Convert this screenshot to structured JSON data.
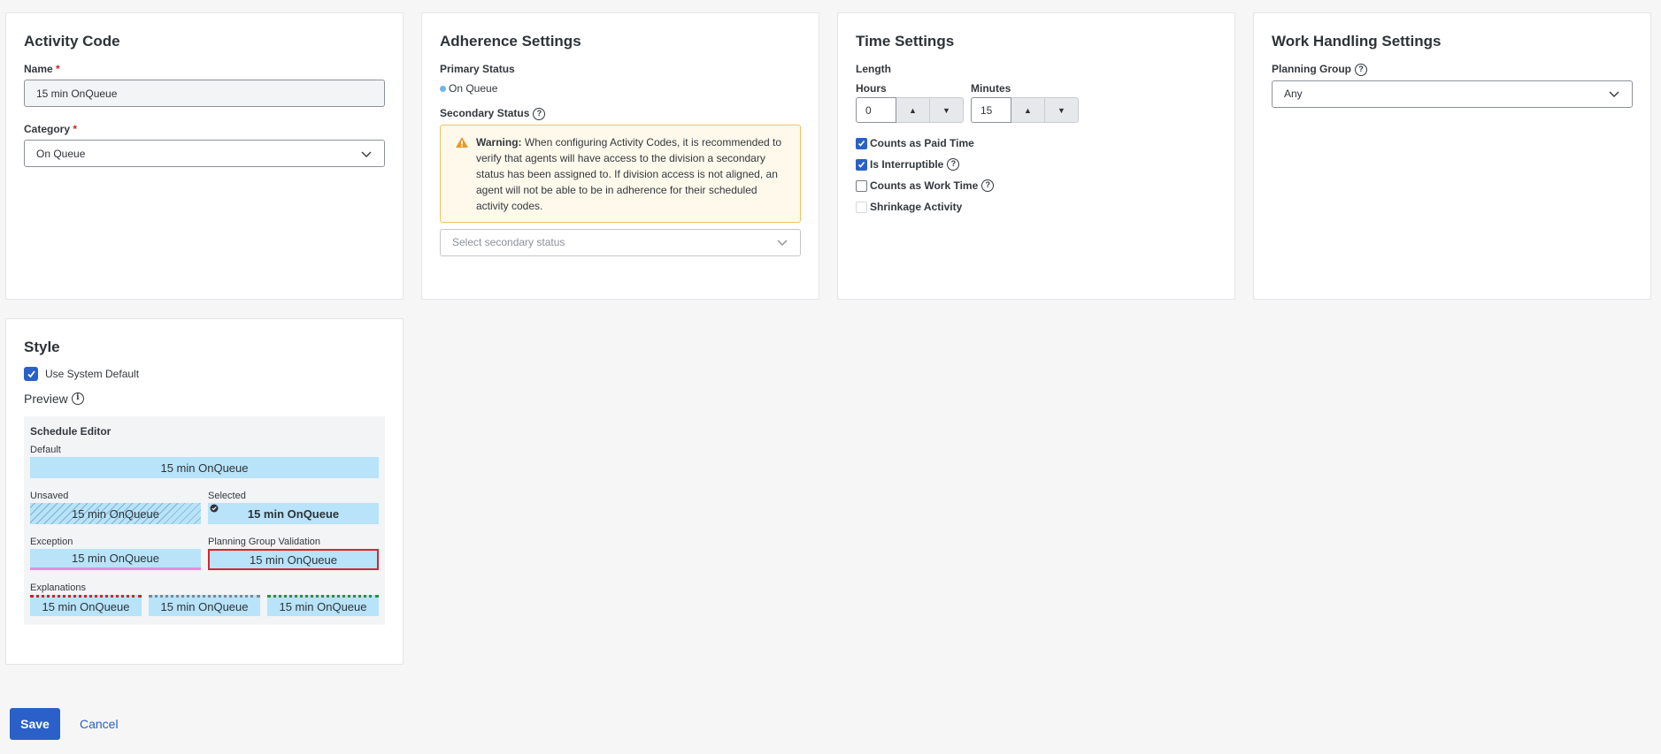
{
  "activity_code": {
    "title": "Activity Code",
    "name_label": "Name",
    "required_mark": "*",
    "name_value": "15 min OnQueue",
    "category_label": "Category",
    "category_value": "On Queue"
  },
  "adherence": {
    "title": "Adherence Settings",
    "primary_label": "Primary Status",
    "primary_value": "On Queue",
    "secondary_label": "Secondary Status",
    "warning_strong": "Warning:",
    "warning_text": "When configuring Activity Codes, it is recommended to verify that agents will have access to the division a secondary status has been assigned to. If division access is not aligned, an agent will not be able to be in adherence for their scheduled activity codes.",
    "secondary_placeholder": "Select secondary status"
  },
  "time": {
    "title": "Time Settings",
    "length_label": "Length",
    "hours_label": "Hours",
    "hours_value": "0",
    "minutes_label": "Minutes",
    "minutes_value": "15",
    "checks": [
      {
        "label": "Counts as Paid Time",
        "checked": true,
        "disabled": false
      },
      {
        "label": "Is Interruptible",
        "checked": true,
        "disabled": false
      },
      {
        "label": "Counts as Work Time",
        "checked": false,
        "disabled": false
      },
      {
        "label": "Shrinkage Activity",
        "checked": false,
        "disabled": true
      }
    ]
  },
  "work_handling": {
    "title": "Work Handling Settings",
    "planning_group_label": "Planning Group",
    "planning_group_value": "Any"
  },
  "style": {
    "title": "Style",
    "use_default_label": "Use System Default",
    "preview_label": "Preview",
    "editor_title": "Schedule Editor",
    "default_label": "Default",
    "unsaved_label": "Unsaved",
    "selected_label": "Selected",
    "exception_label": "Exception",
    "pgv_label": "Planning Group Validation",
    "explanations_label": "Explanations",
    "bar_text": "15 min OnQueue"
  },
  "actions": {
    "save": "Save",
    "cancel": "Cancel"
  },
  "colors": {
    "accent": "#2a60c8",
    "bar": "#b8e3f8",
    "warning_bg": "#fff9ec",
    "warning_border": "#f5c064",
    "status_dot": "#6fb6e6"
  }
}
